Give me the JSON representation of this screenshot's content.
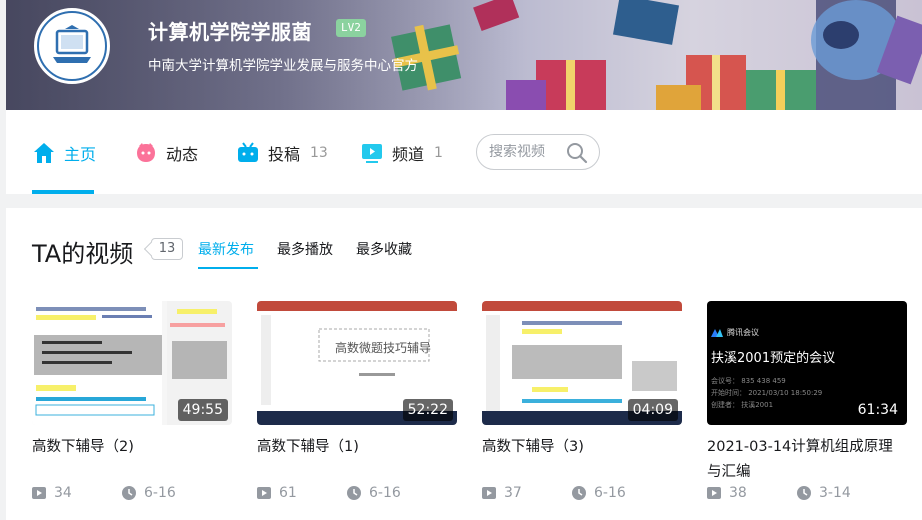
{
  "profile": {
    "username": "计算机学院学服菌",
    "level": "LV2",
    "sign": "中南大学计算机学院学业发展与服务中心官方"
  },
  "nav": {
    "tabs": [
      {
        "label": "主页",
        "count": ""
      },
      {
        "label": "动态",
        "count": ""
      },
      {
        "label": "投稿",
        "count": "13"
      },
      {
        "label": "频道",
        "count": "1"
      }
    ],
    "search_placeholder": "搜索视频"
  },
  "videos_section": {
    "title": "TA的视频",
    "count": "13",
    "sort_options": [
      "最新发布",
      "最多播放",
      "最多收藏"
    ]
  },
  "videos": [
    {
      "title": "高数下辅导（2)",
      "duration": "49:55",
      "plays": "34",
      "date": "6-16"
    },
    {
      "title": "高数下辅导（1)",
      "duration": "52:22",
      "plays": "61",
      "date": "6-16",
      "thumb_text": "高数微题技巧辅导"
    },
    {
      "title": "高数下辅导（3)",
      "duration": "04:09",
      "plays": "37",
      "date": "6-16"
    },
    {
      "title": "2021-03-14计算机组成原理与汇编",
      "duration": "61:34",
      "plays": "38",
      "date": "3-14",
      "thumb_text": "扶溪2001预定的会议",
      "thumb_brand": "腾讯会议",
      "thumb_lines": [
        "会议号：  835 438 459",
        "开始时间：  2021/03/10 18:50:29",
        "创建者：  扶溪2001"
      ]
    }
  ],
  "colors": {
    "accent": "#00aeec",
    "pink": "#fb7299",
    "meta": "#9499a0"
  }
}
